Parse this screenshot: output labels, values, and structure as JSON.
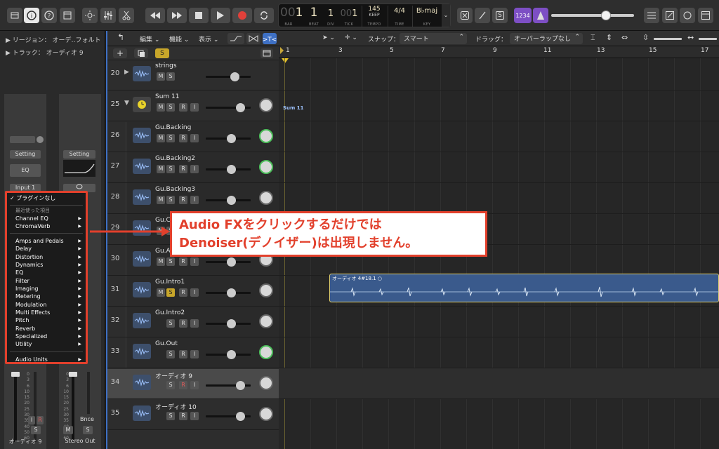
{
  "lcd": {
    "bar_dim": "00",
    "bar": "1",
    "beat": "1",
    "div": "1",
    "tick_dim": "00",
    "tick": "1",
    "bar_label": "BAR",
    "beat_label": "BEAT",
    "div_label": "DIV",
    "tick_label": "TICK",
    "tempo": "145",
    "tempo_sub": "KEEP",
    "tempo_label": "TEMPO",
    "time_sig": "4/4",
    "time_label": "TIME",
    "key": "B♭maj",
    "key_label": "KEY"
  },
  "toolbar": {
    "count_in_label": "1234",
    "solo_label": "S"
  },
  "inspector": {
    "region_row": "リージョン： オーデ‥フォルト",
    "track_row": "トラック： オーディオ 9",
    "setting_label": "Setting",
    "eq_label": "EQ",
    "input_label": "Input 1",
    "left_strip_name": "オーディオ 9",
    "right_strip_name": "Stereo Out",
    "right_strip_bounce": "Bnce",
    "i_label": "I",
    "r_label": "R",
    "m_label": "M",
    "s_label": "S",
    "side_number": "32",
    "fader_scale": [
      "0",
      "3",
      "6",
      "10",
      "15",
      "20",
      "25",
      "30",
      "35",
      "40",
      "50",
      "60"
    ]
  },
  "plugin_menu": {
    "no_plugin": "プラグインなし",
    "recent_header": "最近使った項目",
    "recent": [
      "Channel EQ",
      "ChromaVerb"
    ],
    "categories": [
      "Amps and Pedals",
      "Delay",
      "Distortion",
      "Dynamics",
      "EQ",
      "Filter",
      "Imaging",
      "Metering",
      "Modulation",
      "Multi Effects",
      "Pitch",
      "Reverb",
      "Specialized",
      "Utility"
    ],
    "audio_units": "Audio Units"
  },
  "main_toolbar": {
    "edit": "編集",
    "function": "機能",
    "view": "表示",
    "snap_label": "スナップ：",
    "snap_value": "スマート",
    "drag_label": "ドラッグ：",
    "drag_value": "オーバーラップなし"
  },
  "tracks": [
    {
      "num": "20",
      "name": "strings"
    },
    {
      "num": "25",
      "name": "Sum 11"
    },
    {
      "num": "26",
      "name": "Gu.Backing"
    },
    {
      "num": "27",
      "name": "Gu.Backing2"
    },
    {
      "num": "28",
      "name": "Gu.Backing3"
    },
    {
      "num": "29",
      "name": "Gu.Cu"
    },
    {
      "num": "30",
      "name": "Gu.Al"
    },
    {
      "num": "31",
      "name": "Gu.Intro1"
    },
    {
      "num": "32",
      "name": "Gu.Intro2"
    },
    {
      "num": "33",
      "name": "Gu.Out"
    },
    {
      "num": "34",
      "name": "オーディオ 9"
    },
    {
      "num": "35",
      "name": "オーディオ 10"
    }
  ],
  "ruler": [
    "1",
    "3",
    "5",
    "7",
    "9",
    "11",
    "13",
    "15",
    "17"
  ],
  "arrange": {
    "sum_label": "Sum 11",
    "region_name": "オーディオ 4#18.1"
  },
  "callout": {
    "line1": "Audio FXをクリックするだけでは",
    "line2": "Denoiser(デノイザー)は出現しません。"
  },
  "colors": {
    "accent": "#e2402c",
    "region": "#3a5a8c",
    "solo": "#c8a62a",
    "selection": "#3e70c4"
  }
}
